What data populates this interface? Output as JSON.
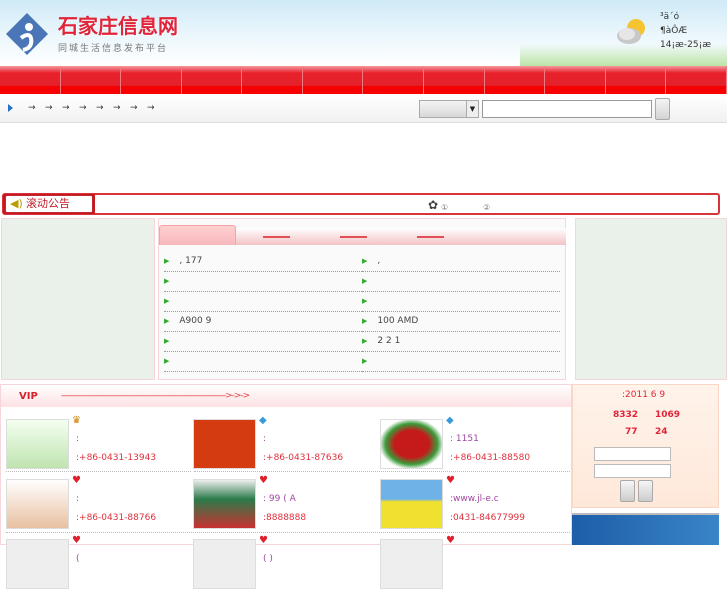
{
  "header": {
    "title": "石家庄信息网",
    "subtitle": "同城生活信息发布平台",
    "weather": {
      "line1": "³ä´ó",
      "line2": "¶àÔÆ",
      "temp": "14¡æ-25¡æ",
      "icon": "partly-cloudy-rain-icon"
    }
  },
  "nav": {
    "count": 12
  },
  "toolbar": {
    "arrows": [
      "→",
      "→",
      "→",
      "→",
      "→",
      "→",
      "→",
      "→"
    ],
    "dropdown_arrow": "▼",
    "search_value": ""
  },
  "notice": {
    "label": "滚动公告",
    "items": [
      "①",
      "②"
    ]
  },
  "tabs": {
    "items": [
      "",
      "",
      "",
      ""
    ]
  },
  "list": {
    "left": [
      ", 177",
      "",
      "",
      "A900 9",
      "",
      ""
    ],
    "right": [
      ",",
      "",
      "",
      "100 AMD",
      "2 2 1",
      ""
    ]
  },
  "vip": {
    "title": "VIP",
    "dash": "------------------------------------------------------------------------->->->",
    "cards": [
      {
        "badge": "crown",
        "l1": ":",
        "l2": ":+86-0431-13943"
      },
      {
        "badge": "diamond",
        "l1": ":",
        "l2": ":+86-0431-87636"
      },
      {
        "badge": "diamond",
        "l1": ":   1151",
        "l2": ":+86-0431-88580"
      },
      {
        "badge": "heart",
        "l1": ":",
        "l2": ":+86-0431-88766"
      },
      {
        "badge": "heart",
        "l1": ": 99 ( A",
        "l2": ":8888888"
      },
      {
        "badge": "heart",
        "l1": ":www.jl-e.c",
        "l2": ":0431-84677999"
      },
      {
        "badge": "heart",
        "l1": "(",
        "l2": ""
      },
      {
        "badge": "heart",
        "l1": "( )",
        "l2": ""
      },
      {
        "badge": "heart",
        "l1": "",
        "l2": ""
      }
    ]
  },
  "side": {
    "date": ":2011 6 9",
    "stat1a": "8332",
    "stat1b": "1069",
    "stat2a": "77",
    "stat2b": "24"
  },
  "colors": {
    "brand": "#e3222c"
  }
}
